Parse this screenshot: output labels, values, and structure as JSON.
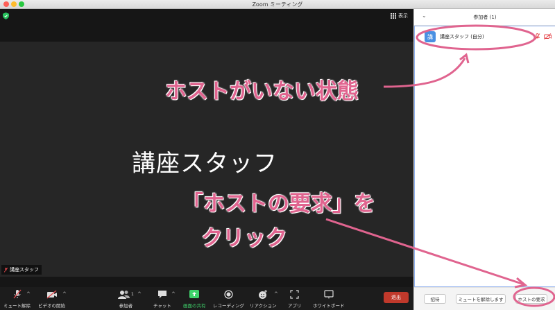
{
  "window": {
    "title": "Zoom ミーティング"
  },
  "stage": {
    "view_label": "表示",
    "speaker_name": "講座スタッフ",
    "name_tag": "講座スタッフ"
  },
  "toolbar": {
    "mute": "ミュート解除",
    "video": "ビデオの開始",
    "participants": "参加者",
    "participants_count": "1",
    "chat": "チャット",
    "share": "画面の共有",
    "record": "レコーディング",
    "reactions": "リアクション",
    "apps": "アプリ",
    "whiteboard": "ホワイトボード",
    "leave": "退出"
  },
  "panel": {
    "title": "参加者 (1)",
    "participants": [
      {
        "avatar": "講",
        "name": "講座スタッフ (自分)"
      }
    ],
    "buttons": {
      "invite": "招待",
      "unmute_all": "ミュートを解除します",
      "claim_host": "ホストの要求"
    }
  },
  "annotations": {
    "no_host": "ホストがいない状態",
    "claim_line1": "「ホストの要求」を",
    "claim_line2": "クリック",
    "color": "#e0648f"
  },
  "colors": {
    "leave": "#c0392b",
    "share_green": "#3fd36b",
    "avatar": "#4a90e2",
    "muted_red": "#e5484d"
  }
}
